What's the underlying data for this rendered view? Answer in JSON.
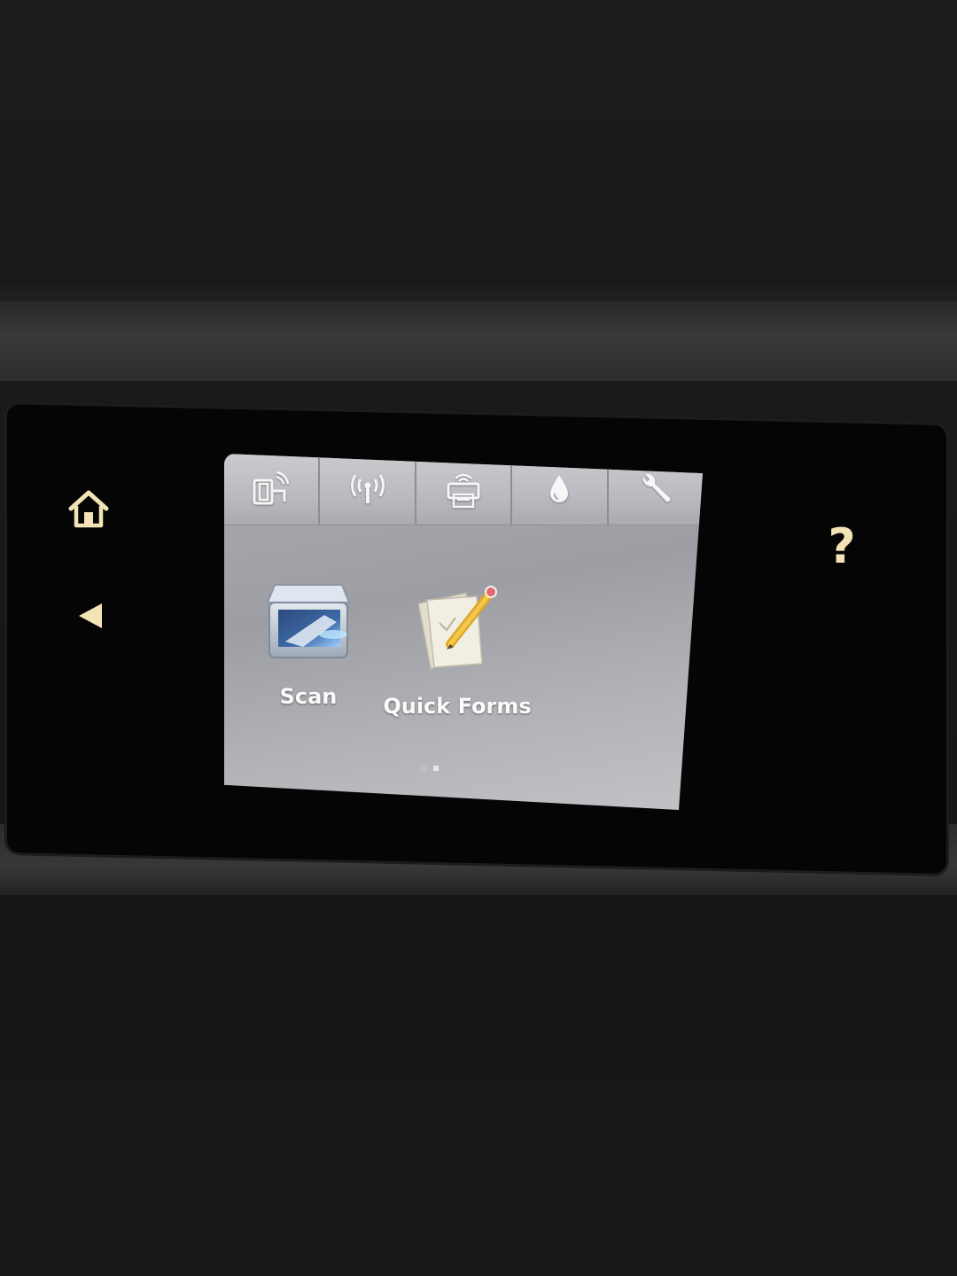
{
  "device": {
    "side_buttons": [
      {
        "name": "home",
        "icon": "home-icon"
      },
      {
        "name": "back",
        "icon": "back-arrow-icon"
      },
      {
        "name": "help",
        "icon": "help-icon",
        "label": "?"
      }
    ],
    "accent_color": "#f3e3b5"
  },
  "toolbar": {
    "tabs": [
      {
        "icon": "wireless-direct-icon"
      },
      {
        "icon": "wireless-icon"
      },
      {
        "icon": "eprint-icon"
      },
      {
        "icon": "ink-icon"
      },
      {
        "icon": "setup-wrench-icon"
      }
    ]
  },
  "apps": [
    {
      "label": "Scan",
      "icon": "scanner-icon"
    },
    {
      "label": "Quick Forms",
      "icon": "quick-forms-icon"
    }
  ],
  "pagination": {
    "total_pages": 2,
    "current_page": 2
  }
}
